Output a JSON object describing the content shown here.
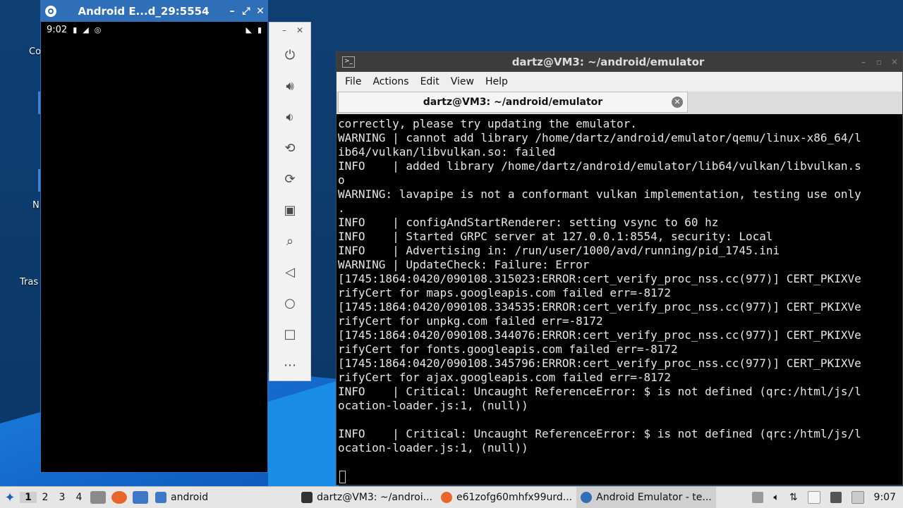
{
  "desktop": {
    "labels": [
      "Co",
      "N",
      "Tras"
    ]
  },
  "emulator": {
    "title": "Android E...d_29:5554",
    "status_time": "9:02",
    "toolbar": [
      "power",
      "volume-up",
      "volume-down",
      "rotate-left",
      "rotate-right",
      "camera",
      "zoom",
      "back",
      "home",
      "overview",
      "more"
    ]
  },
  "terminal": {
    "title": "dartz@VM3: ~/android/emulator",
    "tab_title": "dartz@VM3: ~/android/emulator",
    "menu": [
      "File",
      "Actions",
      "Edit",
      "View",
      "Help"
    ],
    "lines": [
      "correctly, please try updating the emulator.",
      "WARNING | cannot add library /home/dartz/android/emulator/qemu/linux-x86_64/l",
      "ib64/vulkan/libvulkan.so: failed",
      "INFO    | added library /home/dartz/android/emulator/lib64/vulkan/libvulkan.s",
      "o",
      "WARNING: lavapipe is not a conformant vulkan implementation, testing use only",
      ".",
      "INFO    | configAndStartRenderer: setting vsync to 60 hz",
      "INFO    | Started GRPC server at 127.0.0.1:8554, security: Local",
      "INFO    | Advertising in: /run/user/1000/avd/running/pid_1745.ini",
      "WARNING | UpdateCheck: Failure: Error",
      "[1745:1864:0420/090108.315023:ERROR:cert_verify_proc_nss.cc(977)] CERT_PKIXVe",
      "rifyCert for maps.googleapis.com failed err=-8172",
      "[1745:1864:0420/090108.334535:ERROR:cert_verify_proc_nss.cc(977)] CERT_PKIXVe",
      "rifyCert for unpkg.com failed err=-8172",
      "[1745:1864:0420/090108.344076:ERROR:cert_verify_proc_nss.cc(977)] CERT_PKIXVe",
      "rifyCert for fonts.googleapis.com failed err=-8172",
      "[1745:1864:0420/090108.345796:ERROR:cert_verify_proc_nss.cc(977)] CERT_PKIXVe",
      "rifyCert for ajax.googleapis.com failed err=-8172",
      "INFO    | Critical: Uncaught ReferenceError: $ is not defined (qrc:/html/js/l",
      "ocation-loader.js:1, (null))",
      "",
      "INFO    | Critical: Uncaught ReferenceError: $ is not defined (qrc:/html/js/l",
      "ocation-loader.js:1, (null))"
    ]
  },
  "taskbar": {
    "workspaces": [
      "1",
      "2",
      "3",
      "4"
    ],
    "folder_label": "android",
    "tasks": [
      "dartz@VM3: ~/androi...",
      "e61zofg60mhfx99urd...",
      "Android Emulator - te..."
    ],
    "clock": "9:07"
  }
}
